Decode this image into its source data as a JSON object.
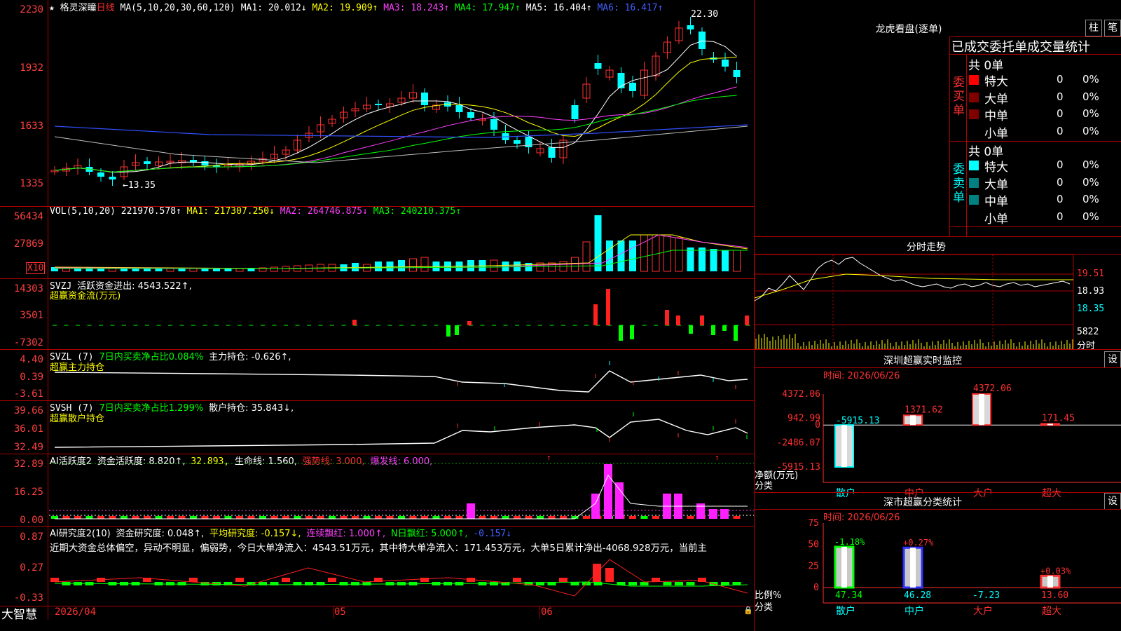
{
  "app": {
    "brand": "大智慧"
  },
  "main": {
    "stock": "格灵深瞳",
    "period": "日线",
    "ma_header": "MA(5,10,20,30,60,120)",
    "ma": [
      {
        "label": "MA1: 20.012↓",
        "color": "#ffffff"
      },
      {
        "label": "MA2: 19.909↑",
        "color": "#ffff00"
      },
      {
        "label": "MA3: 18.243↑",
        "color": "#ff40ff"
      },
      {
        "label": "MA4: 17.947↑",
        "color": "#00ff00"
      },
      {
        "label": "MA5: 16.404↑",
        "color": "#ffffff"
      },
      {
        "label": "MA6: 16.417↑",
        "color": "#4060ff"
      }
    ],
    "y_ticks": [
      "2230",
      "1932",
      "1633",
      "1335"
    ],
    "high_label": "22.30",
    "low_label": "←13.35"
  },
  "vol": {
    "title": "VOL(5,10,20)",
    "value": "221970.578↑",
    "ma1": "MA1: 217307.250↓",
    "ma2": "MA2: 264746.875↓",
    "ma3": "MA3: 240210.375↑",
    "y_ticks": [
      "56434",
      "27869"
    ],
    "unit": "X10"
  },
  "svzj": {
    "title": "SVZJ",
    "desc": "活跃资金进出: 4543.522↑,",
    "sub": "超赢资金流(万元)",
    "y_ticks": [
      "14303",
      "3501",
      "-7302"
    ]
  },
  "svzl": {
    "title": "SVZL (7)",
    "desc_green": "7日内买卖净占比0.084%",
    "desc": "主力持仓: -0.626↑,",
    "sub": "超赢主力持仓",
    "y_ticks": [
      "4.40",
      "0.39",
      "-3.61"
    ]
  },
  "svsh": {
    "title": "SVSH (7)",
    "desc_green": "7日内买卖净占比1.299%",
    "desc": "散户持仓: 35.843↓,",
    "sub": "超赢散户持仓",
    "y_ticks": [
      "39.66",
      "36.01",
      "32.49"
    ]
  },
  "ai_active": {
    "title": "AI活跃度2",
    "v1": "资金活跃度: 8.820↑,",
    "v2": "32.893,",
    "v3": "生命线: 1.560,",
    "v4": "强势线: 3.000,",
    "v5": "爆发线: 6.000,",
    "y_ticks": [
      "32.89",
      "16.25",
      "0.00"
    ]
  },
  "ai_research": {
    "title": "AI研究度2(10)",
    "v1": "资金研究度: 0.048↑,",
    "v2": "平均研究度: -0.157↓,",
    "v3": "连续飘红: 1.000↑,",
    "v4": "N日飘红: 5.000↑,",
    "v5": "-0.157↓",
    "comment": "近期大资金总体偏空，异动不明显，偏弱势，今日大单净流入：4543.51万元，其中特大单净流入：171.453万元，大单5日累计净出-4068.928万元，当前主",
    "y_ticks": [
      "0.87",
      "0.27",
      "-0.33"
    ]
  },
  "x_axis": {
    "labels": [
      "2026/04",
      "05",
      "06"
    ]
  },
  "longhu": {
    "title": "龙虎看盘(逐单)",
    "btn1": "柱",
    "btn2": "笔",
    "header": "已成交委托单成交量统计",
    "buy_label": "委买单",
    "sell_label": "委卖单",
    "buy_total": "共 0单",
    "sell_total": "共 0单",
    "buy_rows": [
      {
        "name": "特大",
        "count": "0",
        "pct": "0%",
        "color": "#ff0000"
      },
      {
        "name": "大单",
        "count": "0",
        "pct": "0%",
        "color": "#800000"
      },
      {
        "name": "中单",
        "count": "0",
        "pct": "0%",
        "color": "#800000"
      },
      {
        "name": "小单",
        "count": "0",
        "pct": "0%",
        "color": "#000000"
      }
    ],
    "sell_rows": [
      {
        "name": "特大",
        "count": "0",
        "pct": "0%",
        "color": "#00ffff"
      },
      {
        "name": "大单",
        "count": "0",
        "pct": "0%",
        "color": "#008080"
      },
      {
        "name": "中单",
        "count": "0",
        "pct": "0%",
        "color": "#008080"
      },
      {
        "name": "小单",
        "count": "0",
        "pct": "0%",
        "color": "#000000"
      }
    ]
  },
  "intraday": {
    "title": "分时走势",
    "price_ticks": [
      "19.51",
      "18.93",
      "18.35"
    ],
    "vol_tick": "5822",
    "vol_label": "分时"
  },
  "sz_monitor": {
    "title": "深圳超赢实时监控",
    "btn": "设",
    "time": "时间: 2026/06/26",
    "y_ticks": [
      "4372.06",
      "942.99",
      "0",
      "-2486.07",
      "-5915.13"
    ],
    "y_label": "净额(万元)",
    "x_label": "分类",
    "categories": [
      "散户",
      "中户",
      "大户",
      "超大"
    ],
    "values": [
      "-5915.13",
      "1371.62",
      "4372.06",
      "171.45"
    ]
  },
  "sz_class": {
    "title": "深市超赢分类统计",
    "btn": "设",
    "time": "时间: 2026/06/26",
    "y_ticks": [
      "75",
      "50",
      "25",
      "0"
    ],
    "y_label": "比例%",
    "x_label": "分类",
    "categories": [
      "散户",
      "中户",
      "大户",
      "超大"
    ],
    "top_labels": [
      "-1.18%",
      "+0.27%",
      "",
      "+0.03%"
    ],
    "bottom_labels": [
      "47.34",
      "46.28",
      "-7.23",
      "13.60"
    ]
  },
  "chart_data": {
    "type": "bar",
    "categories": [
      "散户",
      "中户",
      "大户",
      "超大"
    ],
    "values": [
      -5915.13,
      1371.62,
      4372.06,
      171.45
    ],
    "title": "深圳超赢实时监控",
    "ylabel": "净额(万元)",
    "ylim": [
      -5915.13,
      4372.06
    ]
  }
}
